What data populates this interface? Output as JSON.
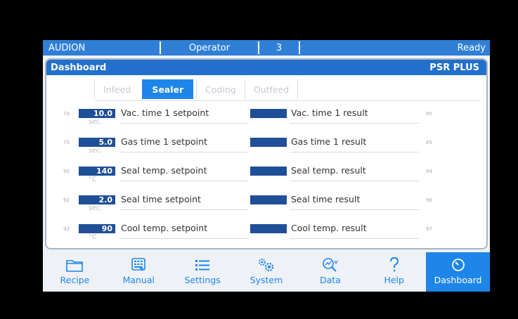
{
  "status_bar": {
    "brand": "AUDION",
    "user_level": "Operator",
    "count": "3",
    "state": "Ready"
  },
  "panel": {
    "title": "Dashboard",
    "model": "PSR PLUS"
  },
  "tabs": [
    {
      "label": "Infeed",
      "active": false
    },
    {
      "label": "Sealer",
      "active": true
    },
    {
      "label": "Coding",
      "active": false
    },
    {
      "label": "Outfeed",
      "active": false
    }
  ],
  "rows": [
    {
      "left_num": "70",
      "value": "10.0",
      "unit": "sec.",
      "setpoint_label": "Vac. time 1 setpoint",
      "result_label": "Vac. time 1 result",
      "right_num": "80"
    },
    {
      "left_num": "75",
      "value": "5.0",
      "unit": "sec.",
      "setpoint_label": "Gas time 1 setpoint",
      "result_label": "Gas time 1 result",
      "right_num": "85"
    },
    {
      "left_num": "90",
      "value": "140",
      "unit": "°C",
      "setpoint_label": "Seal temp. setpoint",
      "result_label": "Seal temp. result",
      "right_num": "94"
    },
    {
      "left_num": "92",
      "value": "2.0",
      "unit": "sec.",
      "setpoint_label": "Seal time setpoint",
      "result_label": "Seal time result",
      "right_num": "96"
    },
    {
      "left_num": "93",
      "value": "90",
      "unit": "°C",
      "setpoint_label": "Cool temp. setpoint",
      "result_label": "Cool temp. result",
      "right_num": "97"
    }
  ],
  "nav": [
    {
      "label": "Recipe",
      "icon": "folder-icon"
    },
    {
      "label": "Manual",
      "icon": "keypad-icon"
    },
    {
      "label": "Settings",
      "icon": "list-icon"
    },
    {
      "label": "System",
      "icon": "gears-icon"
    },
    {
      "label": "Data",
      "icon": "chart-magnifier-icon"
    },
    {
      "label": "Help",
      "icon": "question-icon"
    },
    {
      "label": "Dashboard",
      "icon": "gauge-icon"
    }
  ],
  "colors": {
    "status_blue": "#2f7fd6",
    "header_blue": "#2270cc",
    "accent_blue": "#1e86e8",
    "value_box": "#1f4f96"
  }
}
